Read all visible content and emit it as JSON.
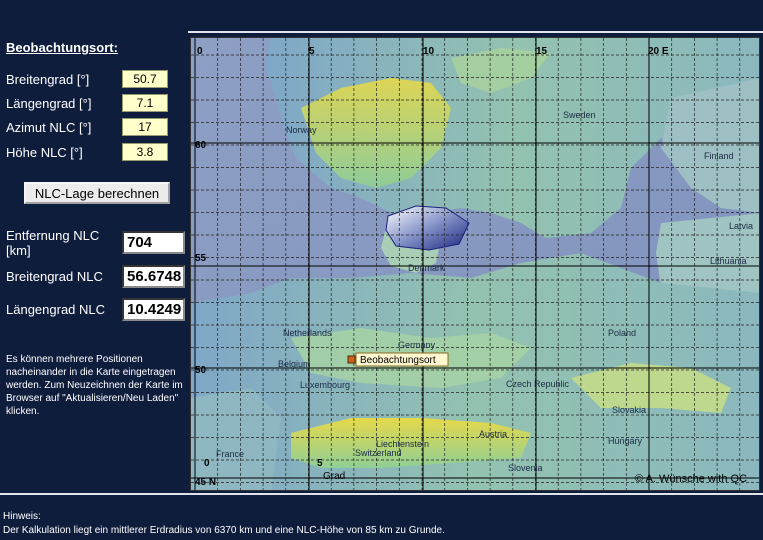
{
  "panel": {
    "title": "Beobachtungsort:",
    "fields": [
      {
        "label": "Breitengrad [°]",
        "value": "50.7"
      },
      {
        "label": "Längengrad [°]",
        "value": "7.1"
      },
      {
        "label": "Azimut NLC [°]",
        "value": "17"
      },
      {
        "label": "Höhe NLC [°]",
        "value": "3.8"
      }
    ],
    "button_label": "NLC-Lage berechnen",
    "results": [
      {
        "label": "Entfernung NLC [km]",
        "value": "704"
      },
      {
        "label": "Breitengrad NLC",
        "value": "56.6748"
      },
      {
        "label": "Längengrad NLC",
        "value": "10.4249"
      }
    ],
    "note": "Es können mehrere Positionen nacheinander in die Karte eingetragen werden. Zum Neuzeichnen der Karte im Browser auf \"Aktualisieren/Neu Laden\" klicken."
  },
  "map": {
    "lon_labels": [
      "0",
      "5",
      "10",
      "15",
      "20 E"
    ],
    "lat_labels": [
      "60",
      "55",
      "50",
      "45 N"
    ],
    "bottom_labels": [
      "0",
      "5"
    ],
    "grad_label": "Grad",
    "countries": [
      "Norway",
      "Sweden",
      "Finland",
      "Latvia",
      "Lithuania",
      "Denmark",
      "Netherlands",
      "Belgium",
      "Luxembourg",
      "Germany",
      "Poland",
      "Czech Republic",
      "Slovakia",
      "Austria",
      "Hungary",
      "Liechtenstein",
      "Switzerland",
      "Slovenia",
      "France"
    ],
    "marker_label": "Beobachtungsort",
    "copyright": "© A. Wünsche with QC"
  },
  "footer": {
    "title": "Hinweis:",
    "text": "Der Kalkulation liegt ein mittlerer Erdradius von 6370 km und eine NLC-Höhe von 85 km zu Grunde."
  }
}
